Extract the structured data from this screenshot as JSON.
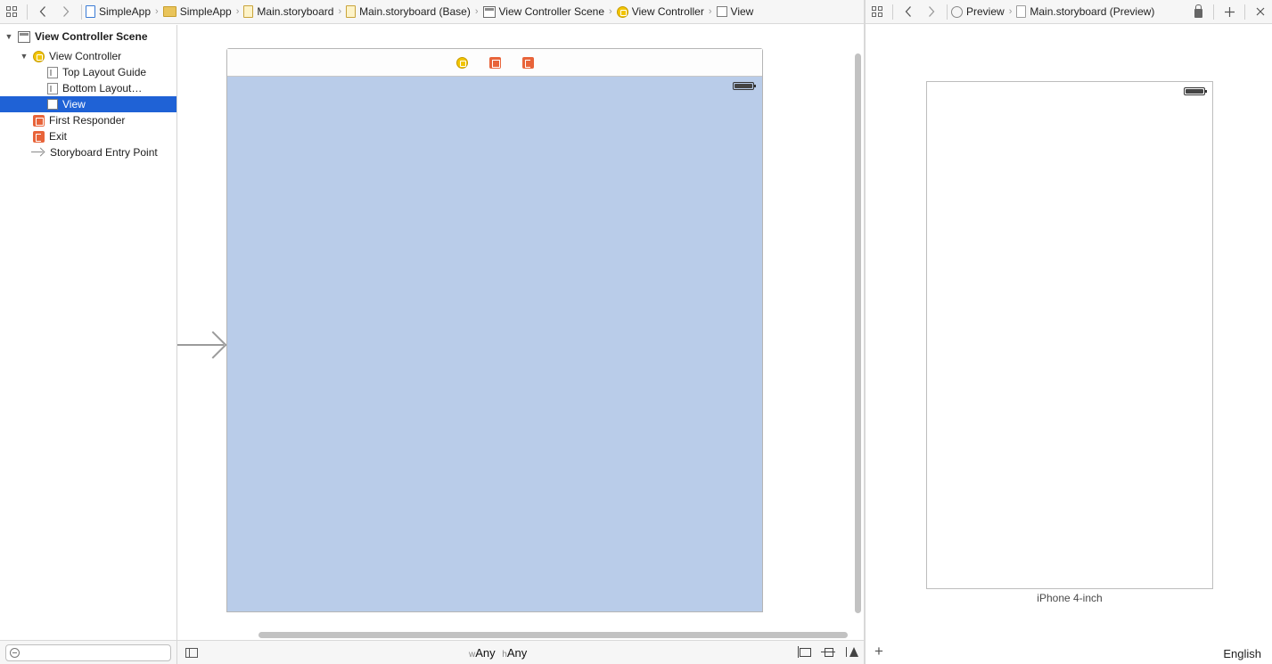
{
  "jumpbar_left": {
    "grid_icon": "grid-icon",
    "back": "‹",
    "forward": "›",
    "crumbs": [
      {
        "label": "SimpleApp",
        "icon": "project-icon"
      },
      {
        "label": "SimpleApp",
        "icon": "folder-icon"
      },
      {
        "label": "Main.storyboard",
        "icon": "storyboard-file-icon"
      },
      {
        "label": "Main.storyboard (Base)",
        "icon": "storyboard-file-icon"
      },
      {
        "label": "View Controller Scene",
        "icon": "scene-icon"
      },
      {
        "label": "View Controller",
        "icon": "view-controller-icon"
      },
      {
        "label": "View",
        "icon": "view-icon"
      }
    ],
    "separator": "›"
  },
  "jumpbar_right": {
    "back": "‹",
    "forward": "›",
    "crumbs": [
      {
        "label": "Preview",
        "icon": "preview-icon"
      },
      {
        "label": "Main.storyboard (Preview)",
        "icon": "storyboard-file-icon"
      }
    ],
    "separator": "›",
    "add": "+"
  },
  "outline": {
    "items": [
      {
        "label": "View Controller Scene",
        "icon": "scene-icon",
        "expanded": "▼"
      },
      {
        "label": "View Controller",
        "icon": "view-controller-icon",
        "expanded": "▼"
      },
      {
        "label": "Top Layout Guide",
        "icon": "layout-guide-icon"
      },
      {
        "label": "Bottom Layout…",
        "icon": "layout-guide-icon"
      },
      {
        "label": "View",
        "icon": "view-icon",
        "selected": true
      },
      {
        "label": "First Responder",
        "icon": "first-responder-icon"
      },
      {
        "label": "Exit",
        "icon": "exit-icon"
      },
      {
        "label": "Storyboard Entry Point",
        "icon": "entry-arrow-icon"
      }
    ]
  },
  "canvas": {
    "view_color": "#b9cce9",
    "size_class": {
      "w_prefix": "w",
      "w_value": "Any",
      "h_prefix": "h",
      "h_value": "Any"
    }
  },
  "preview": {
    "device_label": "iPhone 4-inch",
    "language": "English",
    "add_label": "+"
  },
  "colors": {
    "selection": "#1f62d6",
    "view_controller": "#f2c500",
    "first_responder": "#e8643a"
  }
}
